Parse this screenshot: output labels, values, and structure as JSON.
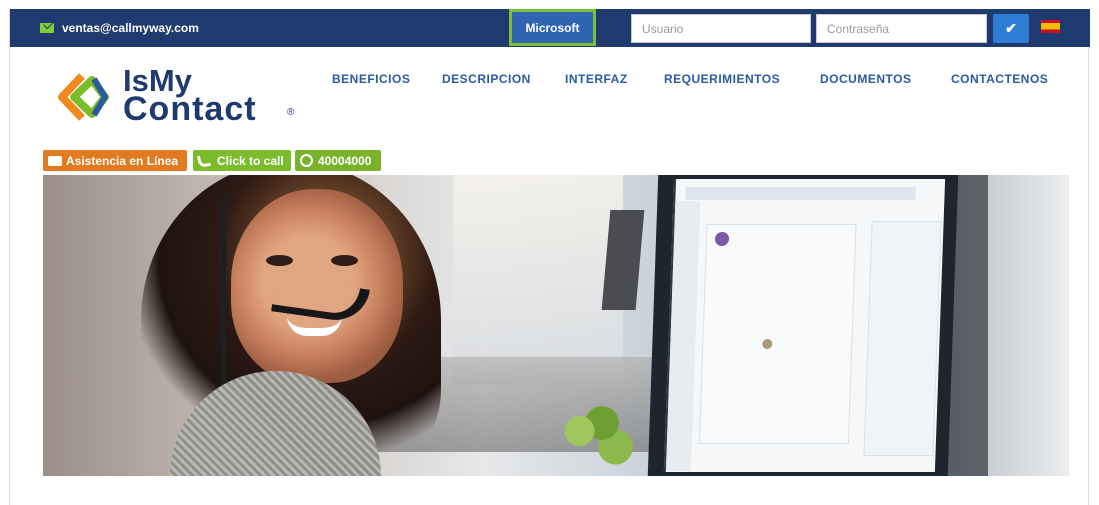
{
  "topbar": {
    "email": "ventas@callmyway.com",
    "microsoft_label": "Microsoft",
    "username_placeholder": "Usuario",
    "password_placeholder": "Contraseña",
    "submit_icon": "check-icon",
    "language_icon": "spain-flag-icon"
  },
  "brand": {
    "line1": "IsMy",
    "line2": "Contact"
  },
  "nav": {
    "items": [
      "BENEFICIOS",
      "DESCRIPCION",
      "INTERFAZ",
      "REQUERIMIENTOS",
      "DOCUMENTOS",
      "CONTACTENOS"
    ]
  },
  "actions": {
    "assistance": "Asistencia en Línea",
    "call": "Click to call",
    "whatsapp": "40004000"
  },
  "colors": {
    "header": "#1f3a6e",
    "accent_green": "#7bbf3b",
    "accent_orange": "#e27b1f",
    "button_blue": "#2f64b2"
  },
  "hero": {
    "image": "agent-with-headset-photo"
  }
}
